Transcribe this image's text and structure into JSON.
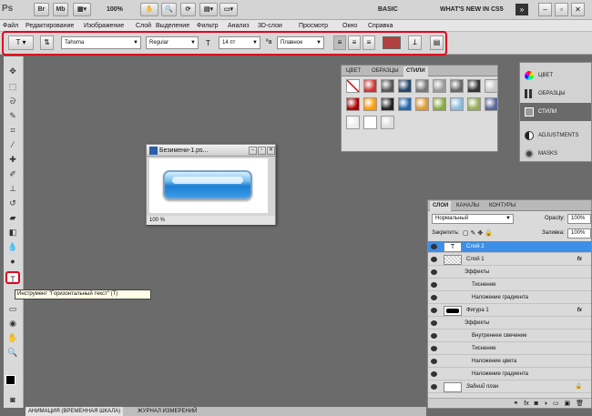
{
  "app": {
    "logo": "Ps",
    "zoom": "100%",
    "workspaces": [
      "BASIC",
      "WHAT'S NEW IN CS5"
    ]
  },
  "menu": [
    "Файл",
    "Редактирование",
    "Изображение",
    "Слой",
    "Выделение",
    "Фильтр",
    "Анализ",
    "3D-слои",
    "Просмотр",
    "Окно",
    "Справка"
  ],
  "options": {
    "font_family": "Tahoma",
    "font_style": "Regular",
    "font_size": "14 пт",
    "antialias": "Плавное",
    "text_color": "#b34040"
  },
  "tooltip": "Инструмент \"Горизонтальный текст\" (T)",
  "document": {
    "title": "Безимени-1.ps...",
    "zoom": "100 %"
  },
  "styles_panel": {
    "tabs": [
      "ЦВЕТ",
      "ОБРАЗЦЫ",
      "СТИЛИ"
    ],
    "active_tab": "СТИЛИ"
  },
  "dock": [
    "ЦВЕТ",
    "ОБРАЗЦЫ",
    "СТИЛИ",
    "ADJUSTMENTS",
    "MASKS"
  ],
  "layers_panel": {
    "tabs": [
      "СЛОИ",
      "КАНАЛЫ",
      "КОНТУРЫ"
    ],
    "blend_mode": "Нормальный",
    "opacity_label": "Opacity:",
    "opacity": "100%",
    "lock_label": "Закрепить:",
    "fill_label": "Заливка:",
    "fill": "100%",
    "layers": [
      {
        "name": "Слой 2",
        "kind": "text",
        "selected": true
      },
      {
        "name": "Слой 1",
        "kind": "pixel",
        "fx": "fx"
      },
      {
        "name": "Эффекты",
        "kind": "effects-header"
      },
      {
        "name": "Тиснение",
        "kind": "effect"
      },
      {
        "name": "Наложение градиента",
        "kind": "effect"
      },
      {
        "name": "Фигура 1",
        "kind": "shape",
        "fx": "fx"
      },
      {
        "name": "Эффекты",
        "kind": "effects-header"
      },
      {
        "name": "Внутреннее свечение",
        "kind": "effect"
      },
      {
        "name": "Тиснение",
        "kind": "effect"
      },
      {
        "name": "Наложение цвета",
        "kind": "effect"
      },
      {
        "name": "Наложение градиента",
        "kind": "effect"
      },
      {
        "name": "Задний план",
        "kind": "background"
      }
    ]
  },
  "bottom_tabs": [
    "АНИМАЦИЯ (ВРЕМЕННАЯ ШКАЛА)",
    "ЖУРНАЛ ИЗМЕРЕНИЙ"
  ]
}
